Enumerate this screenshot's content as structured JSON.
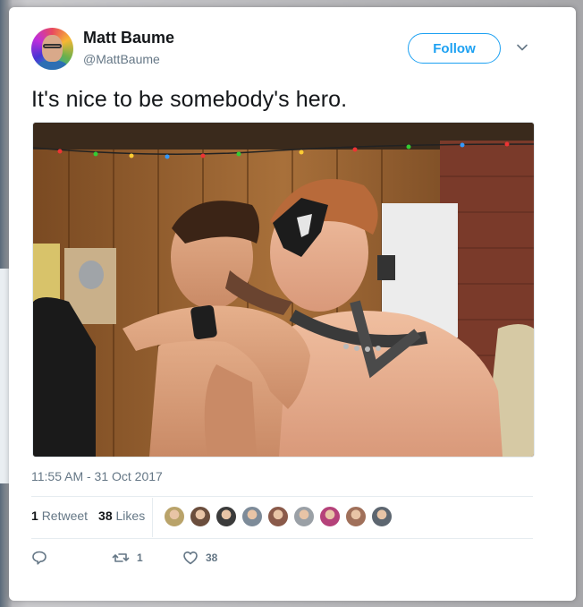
{
  "tweet": {
    "author": {
      "name": "Matt Baume",
      "handle": "@MattBaume",
      "avatar_icon": "profile-avatar"
    },
    "follow_label": "Follow",
    "text": "It's nice to be somebody's hero.",
    "timestamp": "11:55 AM - 31 Oct 2017",
    "stats": {
      "retweets_count": "1",
      "retweets_label": "Retweet",
      "likes_count": "38",
      "likes_label": "Likes"
    },
    "actions": {
      "reply_icon": "reply-icon",
      "retweet_icon": "retweet-icon",
      "retweet_count": "1",
      "like_icon": "heart-icon",
      "like_count": "38"
    },
    "liker_avatar_colors": [
      "#b9a36a",
      "#6b4e3d",
      "#3b3b3b",
      "#7d8b99",
      "#8a5a4a",
      "#9aa0a6",
      "#b5427a",
      "#a0705a",
      "#5d6670"
    ]
  },
  "colors": {
    "accent": "#1da1f2",
    "text_primary": "#14171a",
    "text_secondary": "#657786"
  }
}
